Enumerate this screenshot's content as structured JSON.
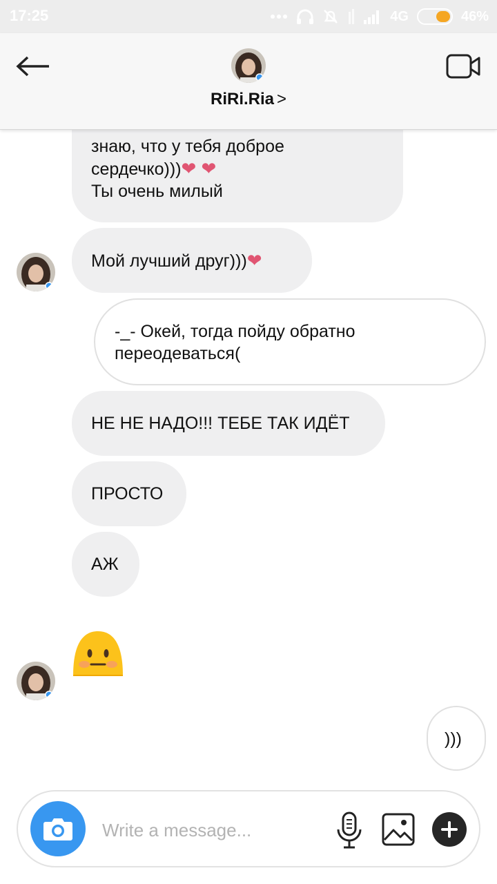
{
  "status_bar": {
    "time": "17:25",
    "network": "4G",
    "battery": "46%",
    "battery_level": 0.46
  },
  "header": {
    "username": "RiRi.Ria",
    "chevron": ">",
    "back_icon": "arrow-left-icon",
    "video_icon": "video-camera-icon"
  },
  "messages": [
    {
      "side": "incoming",
      "lines": [
        "знаю, что у тебя доброе",
        "сердечко)))",
        "Ты очень милый"
      ],
      "hearts": "❤ ❤"
    },
    {
      "side": "incoming",
      "text": "Мой лучший друг)))",
      "heart": "❤"
    },
    {
      "side": "outgoing",
      "lines": [
        "-_- Окей, тогда пойду обратно",
        "переодеваться("
      ]
    },
    {
      "side": "incoming",
      "text": "НЕ НЕ НАДО!!! ТЕБЕ ТАК ИДЁТ"
    },
    {
      "side": "incoming",
      "text": "ПРОСТО"
    },
    {
      "side": "incoming",
      "text": "АЖ"
    },
    {
      "side": "incoming",
      "emoji": "neutral-blushing-face-emoji"
    },
    {
      "side": "outgoing",
      "text": ")))"
    }
  ],
  "composer": {
    "placeholder": "Write a message...",
    "camera_icon": "camera-icon",
    "mic_icon": "microphone-icon",
    "gallery_icon": "image-gallery-icon",
    "plus_icon": "plus-icon"
  },
  "colors": {
    "incoming_bubble": "#efeff0",
    "outgoing_border": "#e0e0e0",
    "accent_blue": "#3897f0",
    "heart": "#e05572"
  }
}
